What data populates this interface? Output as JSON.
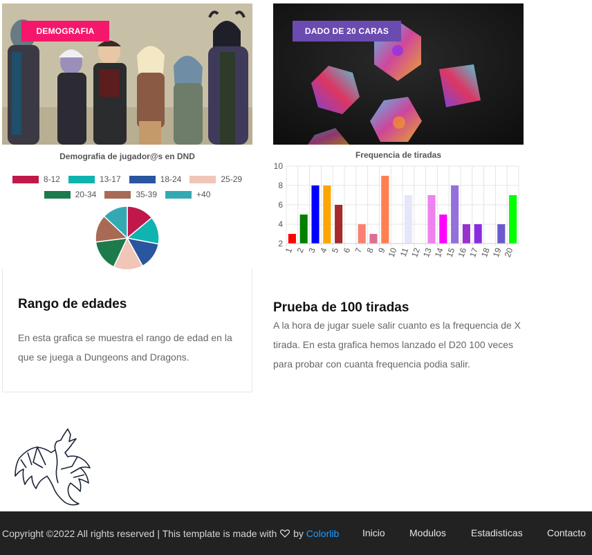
{
  "left_card": {
    "badge": "DEMOGRAFIA",
    "badge_color": "#f5176b",
    "heading": "Rango de edades",
    "body": "En esta grafica se muestra el rango de edad en la que se juega a Dungeons and Dragons."
  },
  "right_card": {
    "badge": "DADO DE 20 CARAS",
    "badge_color": "#6a4bb0",
    "heading": "Prueba de 100 tiradas",
    "body": "A la hora de jugar suele salir cuanto es la frequencia de X tirada. En esta grafica hemos lanzado el D20 100 veces para probar con cuanta frequencia podia salir."
  },
  "chart_data": [
    {
      "type": "pie",
      "title": "Demografia de jugador@s en DND",
      "categories": [
        "8-12",
        "13-17",
        "18-24",
        "25-29",
        "20-34",
        "35-39",
        "+40"
      ],
      "values": [
        14,
        14,
        14,
        15,
        16,
        14,
        13
      ],
      "colors": [
        "#c0184a",
        "#0fb3b0",
        "#2a559f",
        "#f0c6b8",
        "#1d7a4b",
        "#a86a55",
        "#34a9b4"
      ],
      "legend_position": "top"
    },
    {
      "type": "bar",
      "title": "Frequencia de tiradas",
      "categories": [
        "1",
        "2",
        "3",
        "4",
        "5",
        "6",
        "7",
        "8",
        "9",
        "10",
        "11",
        "12",
        "13",
        "14",
        "15",
        "16",
        "17",
        "18",
        "19",
        "20"
      ],
      "values": [
        1,
        3,
        6,
        6,
        4,
        0,
        2,
        1,
        7,
        0,
        5,
        0,
        5,
        3,
        6,
        2,
        2,
        0,
        2,
        5
      ],
      "colors": [
        "#ff0000",
        "#008000",
        "#0000ff",
        "#ffa500",
        "#a52a2a",
        "#ffffff",
        "#fa8072",
        "#db7093",
        "#ff7f50",
        "#ffffff",
        "#e6e6fa",
        "#ffffff",
        "#ee82ee",
        "#ff00ff",
        "#9370db",
        "#9932cc",
        "#8a2be2",
        "#ffffff",
        "#6a5acd",
        "#00ff00"
      ],
      "y_ticks": [
        2,
        4,
        6,
        8,
        10
      ],
      "ylim": [
        2,
        10
      ],
      "grid": true
    }
  ],
  "footer": {
    "copyright_prefix": "Copyright ©2022 All rights reserved | This template is made with",
    "heart_icon": "heart-icon",
    "by": "by",
    "brand": "Colorlib",
    "brand_color": "#1e9bff",
    "nav": [
      "Inicio",
      "Modulos",
      "Estadisticas",
      "Contacto"
    ]
  }
}
